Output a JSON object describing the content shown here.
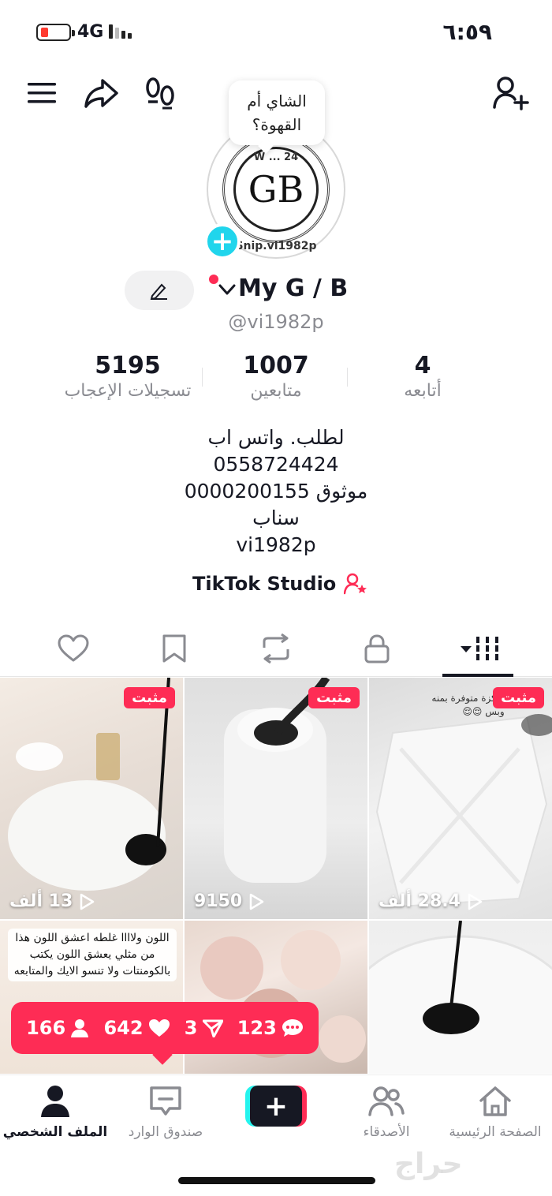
{
  "status_bar": {
    "network": "4G",
    "time": "٦:٥٩",
    "battery_color": "#ff3b30"
  },
  "avatar": {
    "initials": "GB",
    "ring_text_top": "W ... 24",
    "ring_text_bottom": "Snip.vi1982p"
  },
  "bubble": {
    "text": "الشاي أم القهوة؟"
  },
  "profile": {
    "name": "My G / B",
    "handle": "@vi1982p"
  },
  "stats": {
    "likes": {
      "value": "5195",
      "label": "تسجيلات الإعجاب"
    },
    "followers": {
      "value": "1007",
      "label": "متابعين"
    },
    "following": {
      "value": "4",
      "label": "أتابعه"
    }
  },
  "bio": {
    "lines": [
      "لطلب. واتس اب",
      "0558724424",
      "موثوق 0000200155",
      "سناب",
      "vi1982p"
    ]
  },
  "studio": {
    "label": "TikTok Studio"
  },
  "videos": [
    {
      "pinned_label": "مثبت",
      "views": "13 ألف"
    },
    {
      "pinned_label": "مثبت",
      "views": "9150"
    },
    {
      "pinned_label": "مثبت",
      "views": "28.4 ألف",
      "caption": "الوان المركزة متوفرة بمنه وبس 😌😌"
    },
    {
      "caption": "اللون ولاااا غلطه اعشق اللون هذا من مثلي يعشق اللون يكتب بالكومنتات ولا تنسو الايك والمتابعه"
    },
    {},
    {}
  ],
  "popup": {
    "comments": "123",
    "shares": "3",
    "likes": "642",
    "followers": "166"
  },
  "bottom_nav": {
    "home": "الصفحة الرئيسية",
    "friends": "الأصدقاء",
    "inbox": "صندوق الوارد",
    "profile": "الملف الشخصي"
  },
  "watermark": "حراج",
  "colors": {
    "accent": "#fe2c55",
    "cyan": "#20d5ec",
    "text": "#161823",
    "muted": "#8a8b91"
  },
  "icons": [
    "menu-icon",
    "share-icon",
    "footprint-icon",
    "add-user-icon",
    "pencil-icon",
    "chevron-down-icon",
    "heart-icon",
    "bookmark-icon",
    "repost-icon",
    "lock-icon",
    "grid-icon",
    "play-icon",
    "home-icon",
    "friends-icon",
    "inbox-icon",
    "profile-icon",
    "plus-icon"
  ]
}
